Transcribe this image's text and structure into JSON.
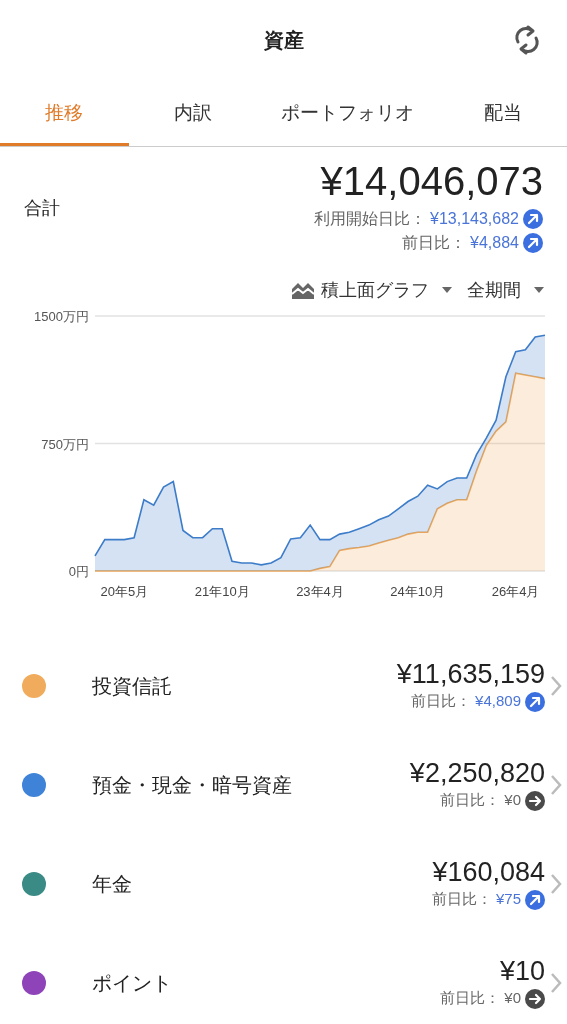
{
  "header": {
    "title": "資産"
  },
  "tabs": [
    {
      "label": "推移",
      "selected": true
    },
    {
      "label": "内訳",
      "selected": false
    },
    {
      "label": "ポートフォリオ",
      "selected": false
    },
    {
      "label": "配当",
      "selected": false
    }
  ],
  "total": {
    "label": "合計",
    "amount": "¥14,046,073",
    "changes": [
      {
        "label": "利用開始日比：",
        "value": "¥13,143,682",
        "kind": "up"
      },
      {
        "label": "前日比：",
        "value": "¥4,884",
        "kind": "up"
      }
    ]
  },
  "chart_controls": {
    "chart_type": "積上面グラフ",
    "period": "全期間"
  },
  "chart_data": {
    "type": "area",
    "stacked": true,
    "categories": [
      null,
      null,
      null,
      "20年5月",
      null,
      null,
      null,
      null,
      null,
      null,
      null,
      null,
      null,
      "21年10月",
      null,
      null,
      null,
      null,
      null,
      null,
      null,
      null,
      null,
      "23年4月",
      null,
      null,
      null,
      null,
      null,
      null,
      null,
      null,
      null,
      "24年10月",
      null,
      null,
      null,
      null,
      null,
      null,
      null,
      null,
      null,
      "26年4月",
      null,
      null,
      null
    ],
    "ylim": [
      0,
      1500
    ],
    "yticks": [
      {
        "value": 0,
        "label": "0円"
      },
      {
        "value": 750,
        "label": "750万円"
      },
      {
        "value": 1500,
        "label": "1500万円"
      }
    ],
    "series": [
      {
        "color": "#f0a95a",
        "values": [
          0,
          0,
          0,
          0,
          0,
          0,
          0,
          0,
          0,
          0,
          0,
          0,
          0,
          0,
          0,
          0,
          0,
          0,
          0,
          0,
          0,
          0,
          0,
          15,
          26,
          121,
          132,
          138,
          147,
          164,
          181,
          196,
          217,
          228,
          228,
          366,
          398,
          419,
          419,
          589,
          738,
          823,
          877,
          1164,
          1153,
          1143,
          1132
        ]
      },
      {
        "color": "#3d7cc9",
        "values": [
          89,
          185,
          185,
          185,
          196,
          419,
          387,
          494,
          526,
          238,
          196,
          196,
          249,
          249,
          57,
          47,
          47,
          36,
          47,
          79,
          189,
          196,
          270,
          170,
          159,
          96,
          96,
          111,
          123,
          138,
          142,
          170,
          192,
          212,
          276,
          117,
          128,
          128,
          128,
          96,
          43,
          64,
          266,
          126,
          149,
          234,
          255
        ]
      }
    ]
  },
  "assets": [
    {
      "name": "投資信託",
      "color": "#f0ac5c",
      "amount": "¥11,635,159",
      "change_label": "前日比：",
      "change": "¥4,809",
      "kind": "up"
    },
    {
      "name": "預金・現金・暗号資産",
      "color": "#3f83d9",
      "amount": "¥2,250,820",
      "change_label": "前日比：",
      "change": "¥0",
      "kind": "flat"
    },
    {
      "name": "年金",
      "color": "#3a8a86",
      "amount": "¥160,084",
      "change_label": "前日比：",
      "change": "¥75",
      "kind": "up"
    },
    {
      "name": "ポイント",
      "color": "#8e44b8",
      "amount": "¥10",
      "change_label": "前日比：",
      "change": "¥0",
      "kind": "flat"
    }
  ]
}
